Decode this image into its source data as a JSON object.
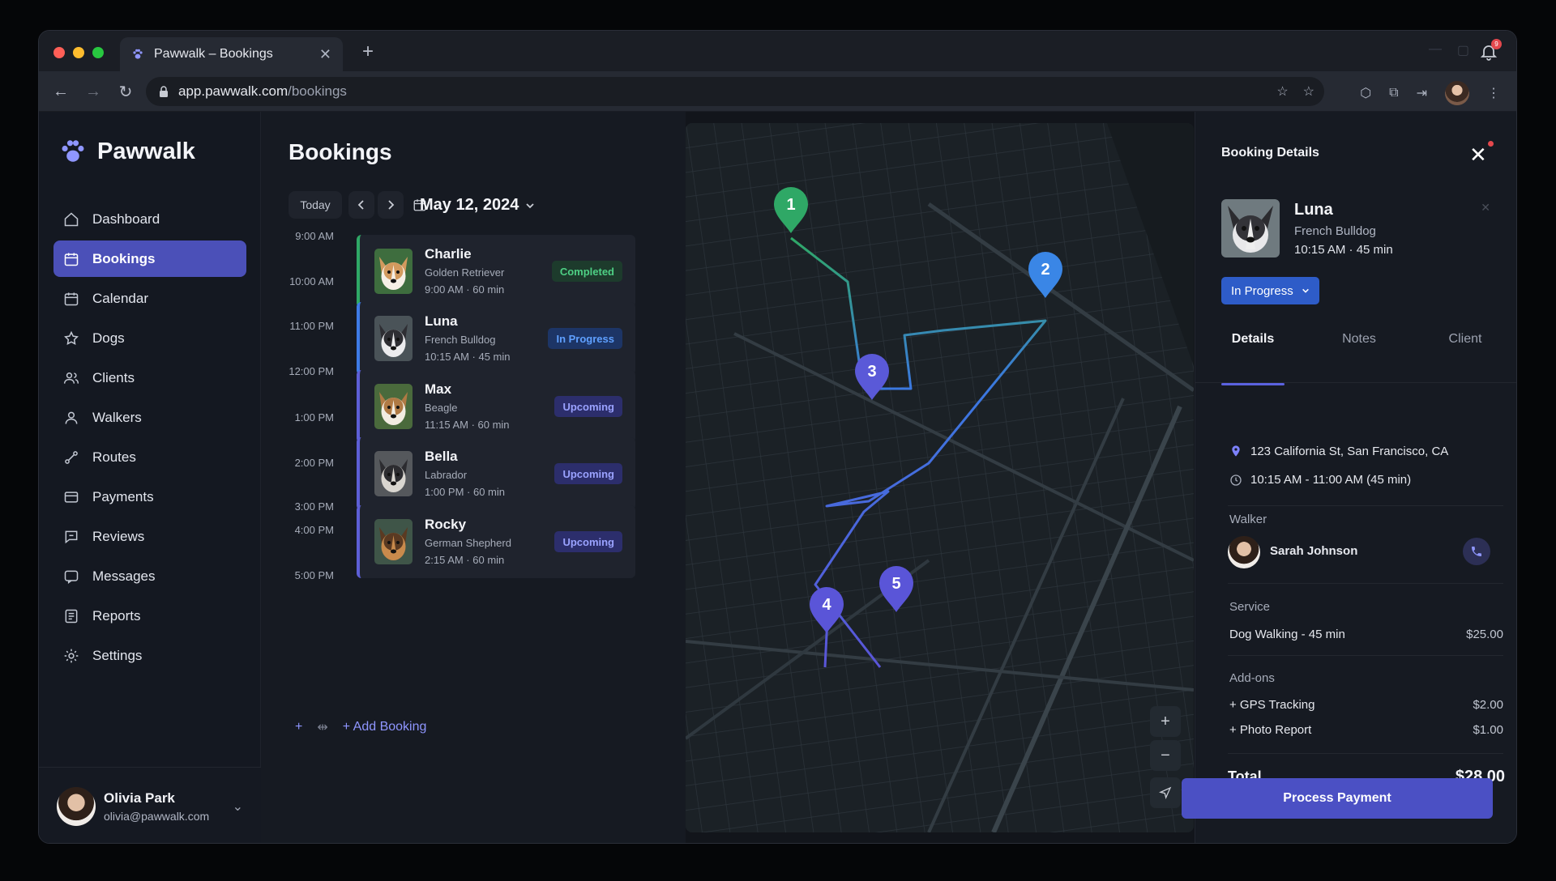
{
  "browser": {
    "tab_title": "Pawwalk – Bookings",
    "url_host": "app.pawwalk.com",
    "url_path": "/bookings",
    "notification_count": "9"
  },
  "app": {
    "name": "Pawwalk"
  },
  "sidebar": {
    "items": [
      {
        "label": "Dashboard",
        "icon": "home-icon"
      },
      {
        "label": "Bookings",
        "icon": "calendar-icon",
        "active": true
      },
      {
        "label": "Calendar",
        "icon": "calendar-icon"
      },
      {
        "label": "Dogs",
        "icon": "star-icon"
      },
      {
        "label": "Clients",
        "icon": "users-icon"
      },
      {
        "label": "Walkers",
        "icon": "user-icon"
      },
      {
        "label": "Routes",
        "icon": "route-icon"
      },
      {
        "label": "Payments",
        "icon": "card-icon"
      },
      {
        "label": "Reviews",
        "icon": "reviews-icon"
      },
      {
        "label": "Messages",
        "icon": "message-icon"
      },
      {
        "label": "Reports",
        "icon": "reports-icon"
      },
      {
        "label": "Settings",
        "icon": "gear-icon"
      }
    ],
    "user": {
      "name": "Olivia Park",
      "email": "olivia@pawwalk.com"
    }
  },
  "bookings": {
    "title": "Bookings",
    "today_label": "Today",
    "date": "May 12, 2024",
    "times": [
      "9:00 AM",
      "10:00 AM",
      "11:00 PM",
      "12:00 PM",
      "1:00 PM",
      "2:00 PM",
      "3:00 PM",
      "4:00 PM",
      "5:00 PM"
    ],
    "cards": [
      {
        "name": "Charlie",
        "breed": "Golden Retriever",
        "time": "9:00 AM · 60 min",
        "status": "Completed",
        "kind": "done",
        "border": "#2fa866"
      },
      {
        "name": "Luna",
        "breed": "French Bulldog",
        "time": "10:15 AM · 45 min",
        "status": "In Progress",
        "kind": "prog",
        "border": "#3e7be6"
      },
      {
        "name": "Max",
        "breed": "Beagle",
        "time": "11:15 AM · 60 min",
        "status": "Upcoming",
        "kind": "up",
        "border": "#5d5fd6"
      },
      {
        "name": "Bella",
        "breed": "Labrador",
        "time": "1:00 PM · 60 min",
        "status": "Upcoming",
        "kind": "up",
        "border": "#5d5fd6"
      },
      {
        "name": "Rocky",
        "breed": "German Shepherd",
        "time": "2:15 AM · 60 min",
        "status": "Upcoming",
        "kind": "up",
        "border": "#5d5fd6"
      }
    ],
    "add_label": "+ Add Booking"
  },
  "map": {
    "pins": [
      "1",
      "2",
      "3",
      "4",
      "5"
    ]
  },
  "details": {
    "title": "Booking Details",
    "dog_name": "Luna",
    "dog_breed": "French Bulldog",
    "dog_time": "10:15 AM · 45 min",
    "status": "In Progress",
    "tabs": [
      "Details",
      "Notes",
      "Client"
    ],
    "address": "123 California St, San Francisco, CA",
    "time_range": "10:15 AM - 11:00 AM (45 min)",
    "walker_label": "Walker",
    "walker_name": "Sarah Johnson",
    "service_label": "Service",
    "service_name": "Dog Walking - 45 min",
    "service_price": "$25.00",
    "addons_label": "Add-ons",
    "addons": [
      {
        "name": "+ GPS Tracking",
        "price": "$2.00"
      },
      {
        "name": "+ Photo Report",
        "price": "$1.00"
      }
    ],
    "total_label": "Total",
    "total_value": "$28.00",
    "pay_label": "Process Payment"
  }
}
